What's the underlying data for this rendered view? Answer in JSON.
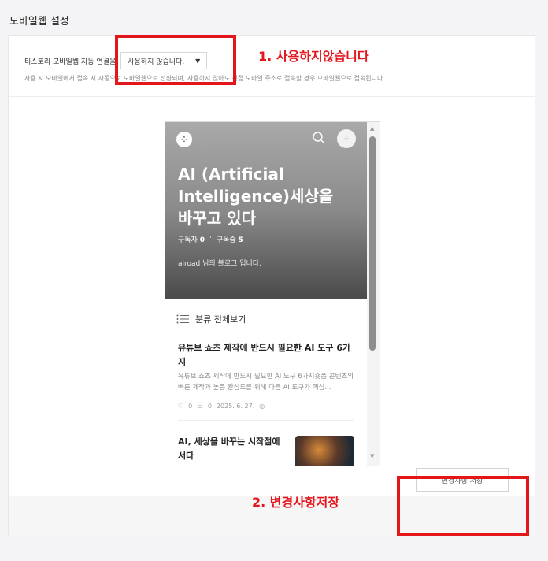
{
  "page": {
    "title": "모바일웹 설정"
  },
  "setting": {
    "label": "티스토리 모바일웹 자동 연결을",
    "select_value": "사용하지 않습니다.",
    "description": "사용 시 모바일에서 접속 시 자동으로 모바일웹으로 전환되며, 사용하지 않아도 직접 모바일 주소로 접속할 경우 모바일웹으로 접속됩니다."
  },
  "preview": {
    "logo_icon": "tistory-logo-icon",
    "blog_title": "AI (Artificial Intelligence)세상을 바꾸고 있다",
    "subscribers_label": "구독자",
    "subscribers_value": "0",
    "following_label": "구독중",
    "following_value": "5",
    "blog_description": "airoad 님의 블로그 입니다.",
    "category_label": "분류 전체보기",
    "posts": [
      {
        "title": "유튜브 쇼츠 제작에 반드시 필요한 AI 도구 6가지",
        "excerpt": "유튜브 쇼츠 제작에 반드시 필요한 AI 도구 6가지숏폼 콘텐츠의 빠른 제작과 높은 완성도를 위해 다음 AI 도구가 핵심...",
        "likes": "0",
        "comments": "0",
        "date": "2025. 6. 27."
      },
      {
        "title": "AI, 세상을 바꾸는 시작점에 서다"
      }
    ]
  },
  "footer": {
    "save_label": "변경사항 저장"
  },
  "annotations": {
    "label1": "1. 사용하지않습니다",
    "label2": "2. 변경사항저장",
    "color": "#e3161c"
  }
}
